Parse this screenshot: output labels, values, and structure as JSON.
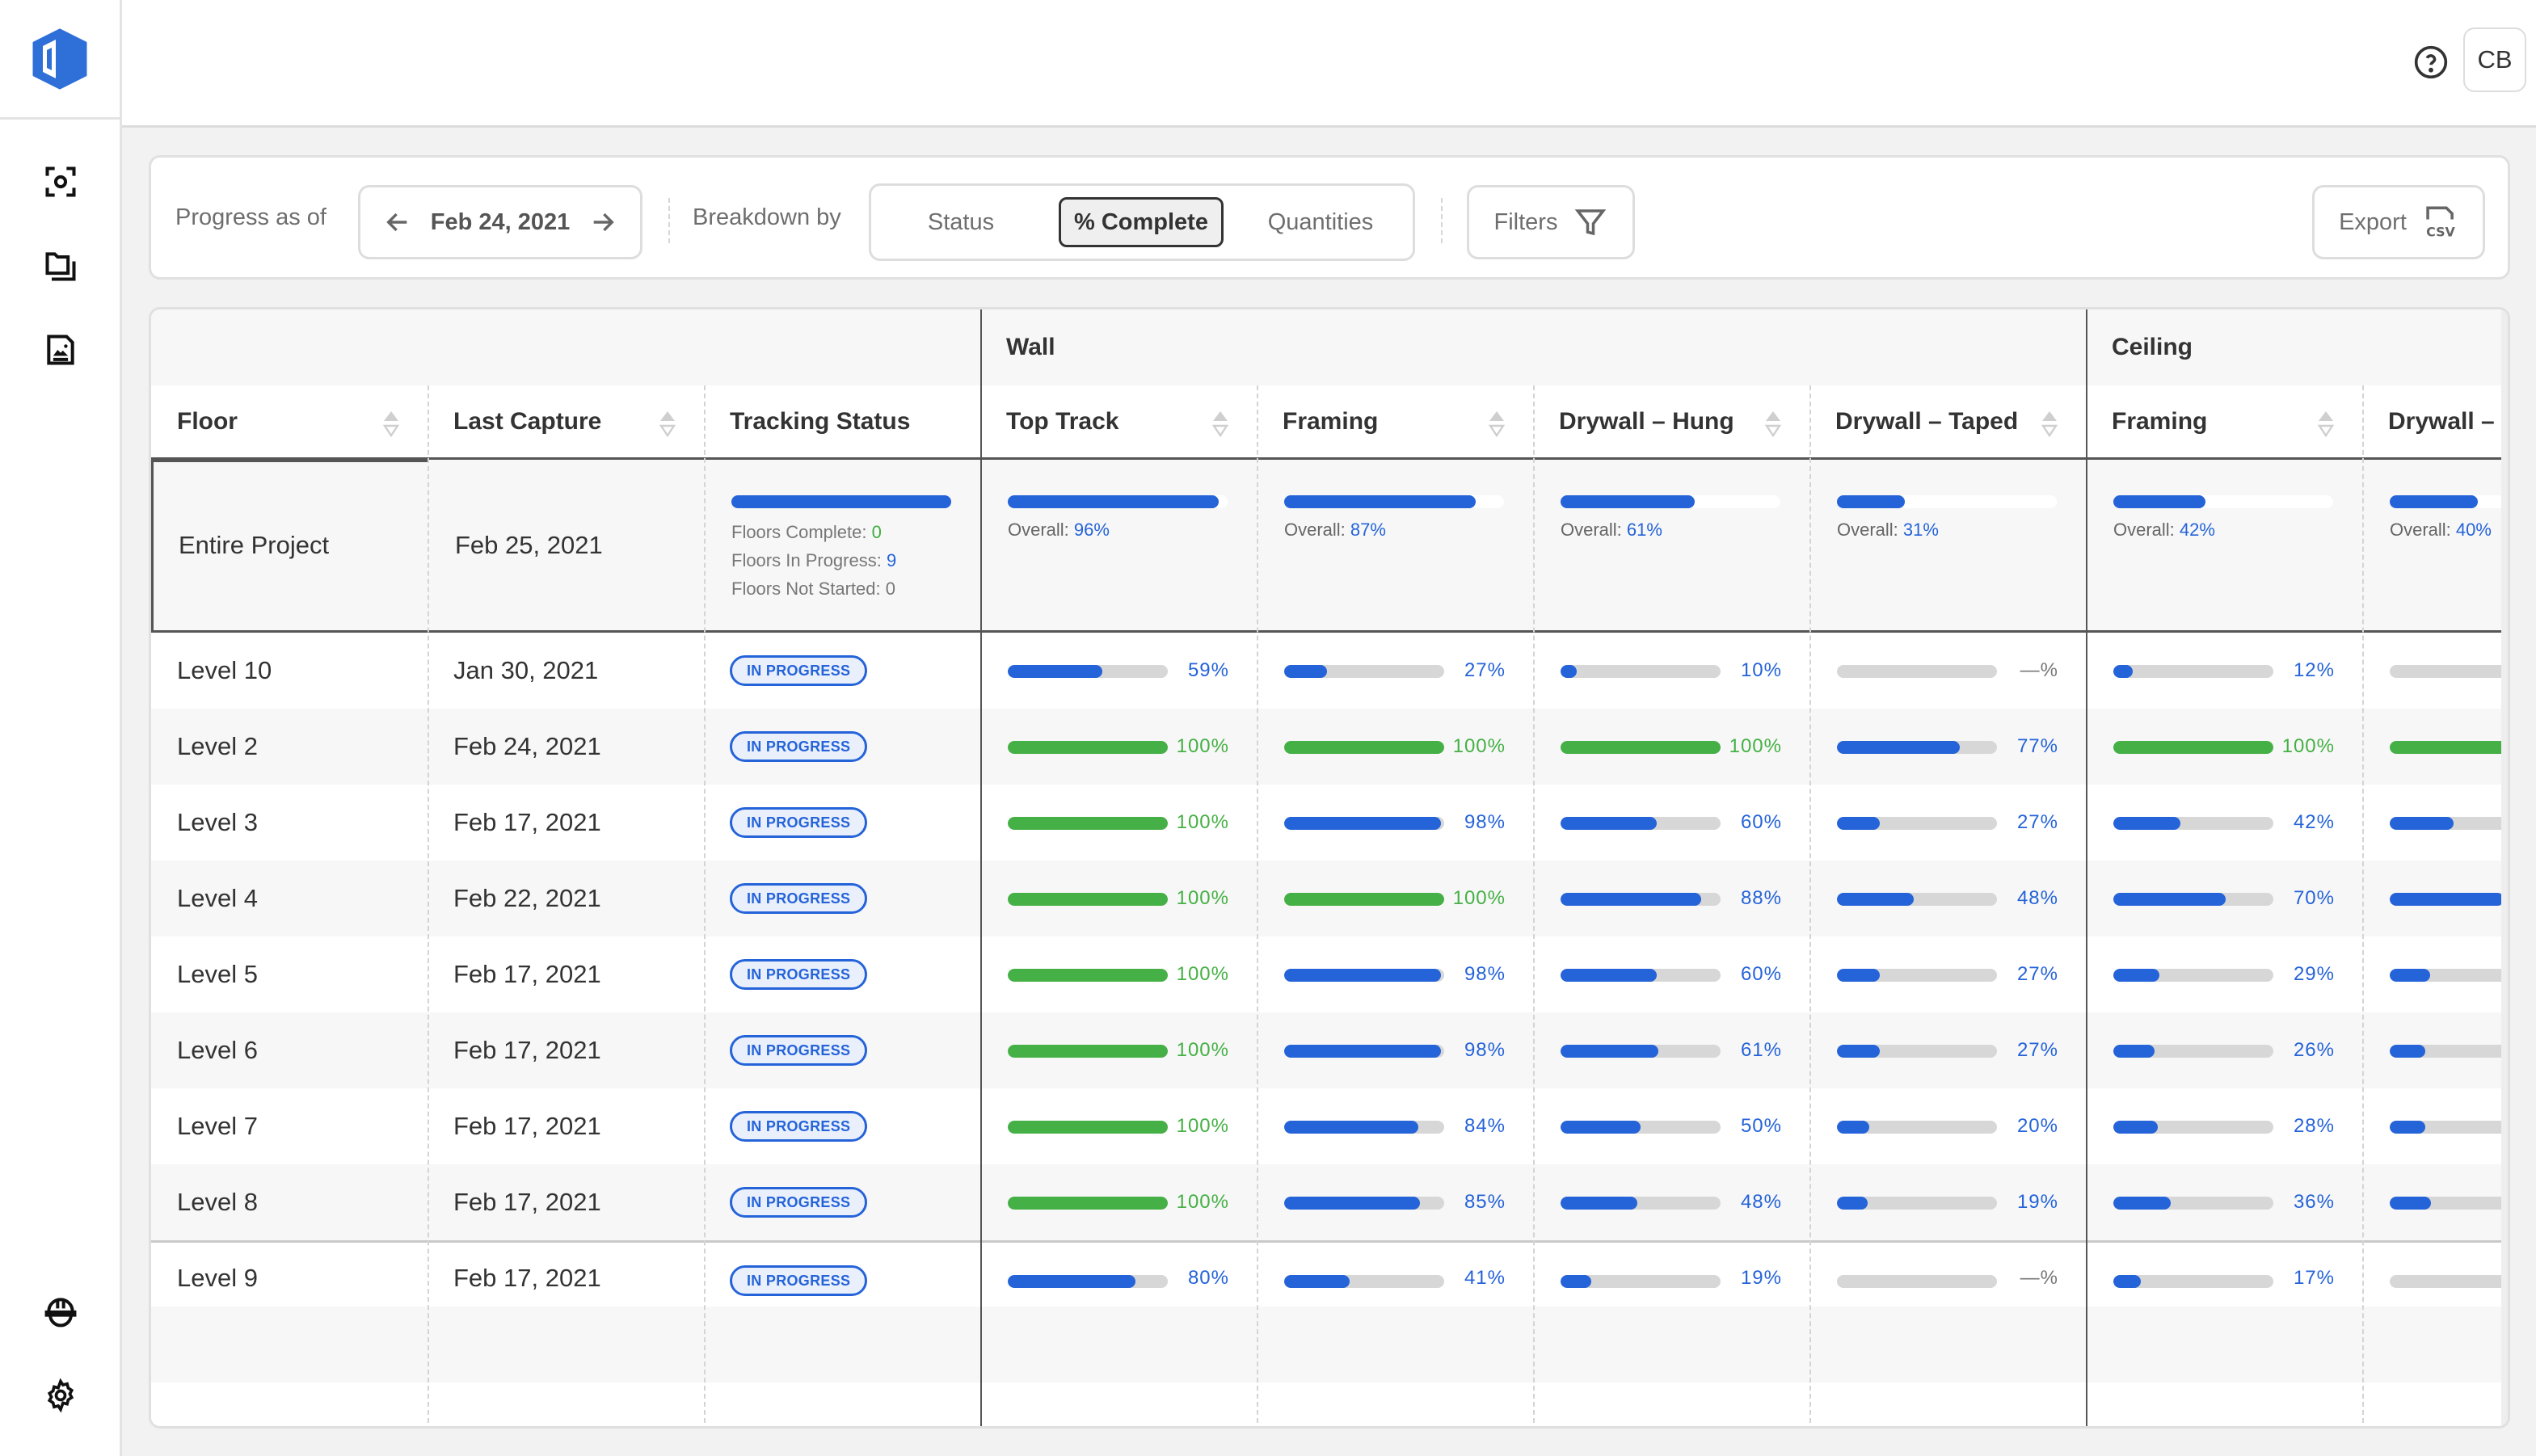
{
  "app": {
    "brand_color": "#2f6fd8",
    "user_initials": "CB"
  },
  "sidebar": {
    "items": [
      {
        "name": "capture",
        "icon": "camera-focus-icon"
      },
      {
        "name": "folders",
        "icon": "folders-icon"
      },
      {
        "name": "reports",
        "icon": "image-document-icon"
      }
    ],
    "bottom_items": [
      {
        "name": "team",
        "icon": "hard-hat-icon"
      },
      {
        "name": "settings",
        "icon": "gear-icon"
      }
    ]
  },
  "toolbar": {
    "progress_label": "Progress as of",
    "date": "Feb 24, 2021",
    "breakdown_label": "Breakdown by",
    "breakdown_options": [
      "Status",
      "% Complete",
      "Quantities"
    ],
    "breakdown_selected": "% Complete",
    "filters_label": "Filters",
    "export_label": "Export",
    "export_format": "CSV"
  },
  "colors": {
    "in_progress": "#2563d9",
    "complete": "#45b045",
    "track": "#d7d7d7",
    "empty_pct": "#777777"
  },
  "table": {
    "groups": [
      {
        "label": "Wall",
        "columns": [
          "Top Track",
          "Framing",
          "Drywall – Hung",
          "Drywall – Taped"
        ]
      },
      {
        "label": "Ceiling",
        "columns": [
          "Framing",
          "Drywall – H"
        ]
      }
    ],
    "fixed_columns": [
      "Floor",
      "Last Capture",
      "Tracking Status"
    ],
    "summary": {
      "floor": "Entire Project",
      "last_capture": "Feb 25, 2021",
      "tracking_progress": 1.0,
      "floors_complete_label": "Floors Complete:",
      "floors_complete": "0",
      "floors_in_progress_label": "Floors In Progress:",
      "floors_in_progress": "9",
      "floors_not_started_label": "Floors Not Started:",
      "floors_not_started": "0",
      "overall_label": "Overall:",
      "overall": [
        "96%",
        "87%",
        "61%",
        "31%",
        "42%",
        "40%"
      ],
      "overall_values": [
        96,
        87,
        61,
        31,
        42,
        40
      ]
    },
    "rows": [
      {
        "floor": "Level 10",
        "last_capture": "Jan 30, 2021",
        "status": "IN PROGRESS",
        "values": [
          59,
          27,
          10,
          null,
          12,
          null
        ],
        "labels": [
          "59%",
          "27%",
          "10%",
          "—%",
          "12%",
          ""
        ]
      },
      {
        "floor": "Level 2",
        "last_capture": "Feb 24, 2021",
        "status": "IN PROGRESS",
        "values": [
          100,
          100,
          100,
          77,
          100,
          100
        ],
        "labels": [
          "100%",
          "100%",
          "100%",
          "77%",
          "100%",
          ""
        ]
      },
      {
        "floor": "Level 3",
        "last_capture": "Feb 17, 2021",
        "status": "IN PROGRESS",
        "values": [
          100,
          98,
          60,
          27,
          42,
          40
        ],
        "labels": [
          "100%",
          "98%",
          "60%",
          "27%",
          "42%",
          ""
        ]
      },
      {
        "floor": "Level 4",
        "last_capture": "Feb 22, 2021",
        "status": "IN PROGRESS",
        "values": [
          100,
          100,
          88,
          48,
          70,
          71
        ],
        "labels": [
          "100%",
          "100%",
          "88%",
          "48%",
          "70%",
          ""
        ]
      },
      {
        "floor": "Level 5",
        "last_capture": "Feb 17, 2021",
        "status": "IN PROGRESS",
        "values": [
          100,
          98,
          60,
          27,
          29,
          25
        ],
        "labels": [
          "100%",
          "98%",
          "60%",
          "27%",
          "29%",
          ""
        ]
      },
      {
        "floor": "Level 6",
        "last_capture": "Feb 17, 2021",
        "status": "IN PROGRESS",
        "values": [
          100,
          98,
          61,
          27,
          26,
          22
        ],
        "labels": [
          "100%",
          "98%",
          "61%",
          "27%",
          "26%",
          ""
        ]
      },
      {
        "floor": "Level 7",
        "last_capture": "Feb 17, 2021",
        "status": "IN PROGRESS",
        "values": [
          100,
          84,
          50,
          20,
          28,
          22
        ],
        "labels": [
          "100%",
          "84%",
          "50%",
          "20%",
          "28%",
          ""
        ]
      },
      {
        "floor": "Level 8",
        "last_capture": "Feb 17, 2021",
        "status": "IN PROGRESS",
        "values": [
          100,
          85,
          48,
          19,
          36,
          26
        ],
        "labels": [
          "100%",
          "85%",
          "48%",
          "19%",
          "36%",
          ""
        ]
      },
      {
        "floor": "Level 9",
        "last_capture": "Feb 17, 2021",
        "status": "IN PROGRESS",
        "values": [
          80,
          41,
          19,
          null,
          17,
          null
        ],
        "labels": [
          "80%",
          "41%",
          "19%",
          "—%",
          "17%",
          ""
        ]
      }
    ]
  }
}
